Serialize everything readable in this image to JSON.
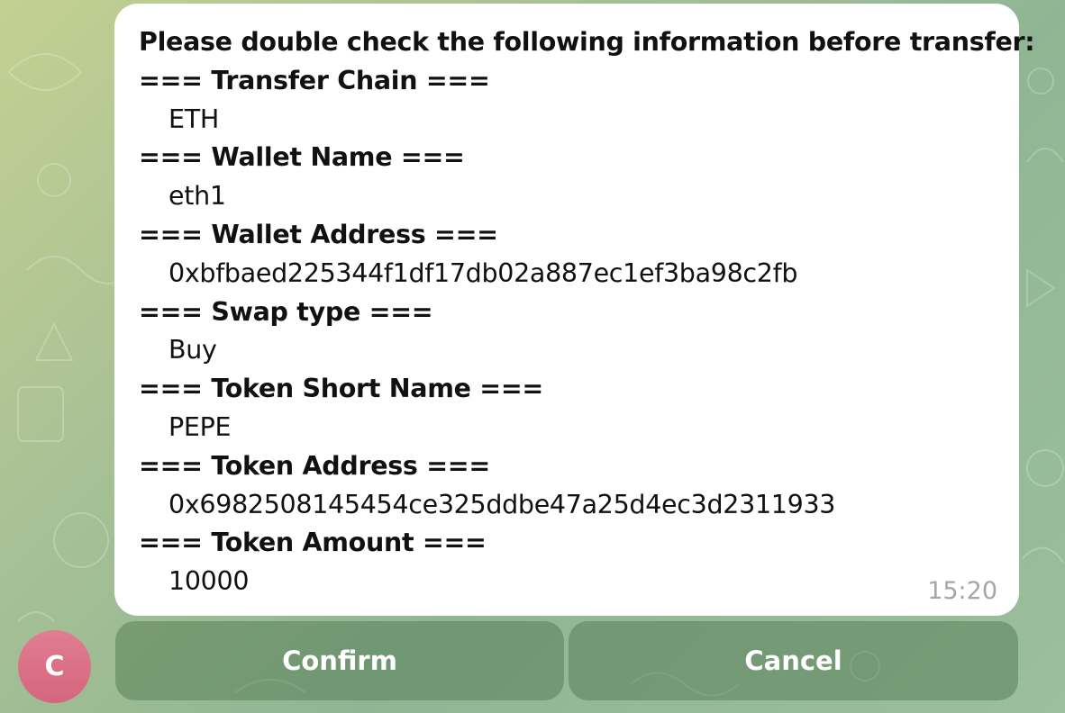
{
  "message": {
    "lines": [
      {
        "text": "Please double check the following information before transfer:",
        "style": "heading"
      },
      {
        "text": "=== Transfer Chain ===",
        "style": "heading"
      },
      {
        "text": "ETH",
        "style": "value"
      },
      {
        "text": "=== Wallet Name ===",
        "style": "heading"
      },
      {
        "text": "eth1",
        "style": "value"
      },
      {
        "text": "=== Wallet Address ===",
        "style": "heading"
      },
      {
        "text": "0xbfbaed225344f1df17db02a887ec1ef3ba98c2fb",
        "style": "value"
      },
      {
        "text": "=== Swap type ===",
        "style": "heading"
      },
      {
        "text": "Buy",
        "style": "value"
      },
      {
        "text": "=== Token Short Name ===",
        "style": "heading"
      },
      {
        "text": "PEPE",
        "style": "value"
      },
      {
        "text": "=== Token Address ===",
        "style": "heading"
      },
      {
        "text": "0x6982508145454ce325ddbe47a25d4ec3d2311933",
        "style": "value"
      },
      {
        "text": "=== Token Amount ===",
        "style": "heading"
      },
      {
        "text": "10000",
        "style": "value"
      }
    ],
    "timestamp": "15:20"
  },
  "avatar": {
    "initial": "C",
    "color": "#d9687f"
  },
  "keyboard": {
    "confirm_label": "Confirm",
    "cancel_label": "Cancel"
  },
  "colors": {
    "bubble": "#ffffff",
    "button_overlay": "rgba(70,110,70,0.42)",
    "timestamp": "#a3a7ab"
  }
}
